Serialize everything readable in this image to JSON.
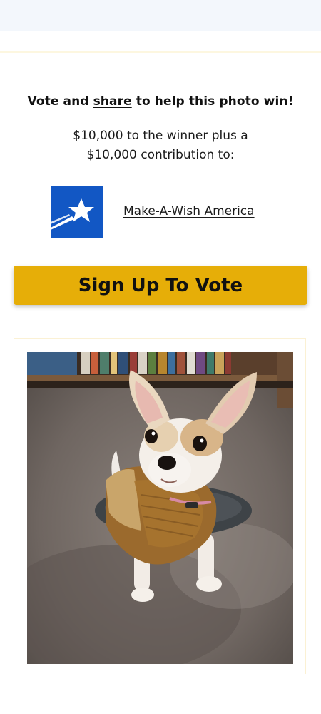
{
  "headline": {
    "before": "Vote and ",
    "share_link": "share",
    "after": " to help this photo win!"
  },
  "prize": {
    "line1": "$10,000 to the winner plus a",
    "line2": "$10,000 contribution to:"
  },
  "charity": {
    "name": "Make-A-Wish America",
    "logo_icon": "make-a-wish-star-icon",
    "logo_color": "#1257c4"
  },
  "cta": {
    "label": "Sign Up To Vote",
    "color": "#e6ae08"
  },
  "photo": {
    "subject": "chihuahua-puppy-photo"
  }
}
